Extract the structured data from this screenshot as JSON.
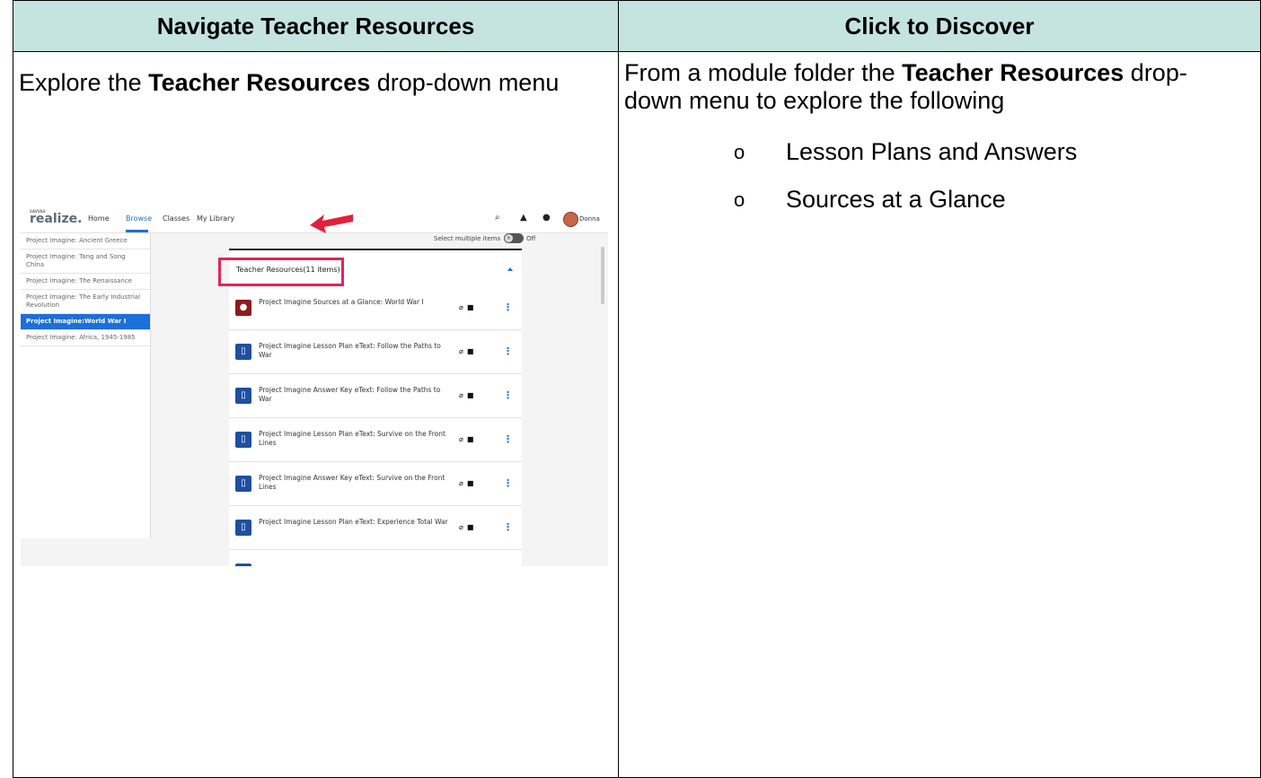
{
  "table": {
    "left_header": "Navigate Teacher Resources",
    "right_header": "Click to Discover",
    "left_text_pre": "Explore the ",
    "left_text_bold": "Teacher Resources",
    "left_text_post": " drop-down menu",
    "right_text_pre": "From a module folder the ",
    "right_text_bold": "Teacher Resources",
    "right_text_post": " drop-down menu to explore the following",
    "bullet_mark": "o",
    "bullets": [
      "Lesson Plans and Answers",
      "Sources at a Glance"
    ]
  },
  "screenshot": {
    "logo_small": "SAVVAS",
    "logo": "realize.",
    "nav": [
      "Home",
      "Browse",
      "Classes",
      "My Library"
    ],
    "active_nav": "Browse",
    "user": "Donna",
    "sidebar": [
      "Project Imagine: Ancient Greece",
      "Project Imagine: Tang and Song China",
      "Project Imagine: The Renaissance",
      "Project Imagine: The Early Industrial Revolution",
      "Project Imagine:World War I",
      "Project Imagine: Africa, 1945-1985"
    ],
    "active_sidebar": "Project Imagine:World War I",
    "select_multiple": "Select multiple items",
    "toggle_label": "Off",
    "folder_title": "Teacher Resources(11 items)",
    "items": [
      {
        "title": "Project Imagine Sources at a Glance: World War I",
        "icon": "apple-icon"
      },
      {
        "title": "Project Imagine Lesson Plan eText: Follow the Paths to War",
        "icon": "book-icon"
      },
      {
        "title": "Project Imagine Answer Key eText: Follow the Paths to War",
        "icon": "book-icon"
      },
      {
        "title": "Project Imagine Lesson Plan eText: Survive on the Front Lines",
        "icon": "book-icon"
      },
      {
        "title": "Project Imagine Answer Key eText: Survive on the Front Lines",
        "icon": "book-icon"
      },
      {
        "title": "Project Imagine Lesson Plan eText: Experience Total War",
        "icon": "book-icon"
      }
    ],
    "colors": {
      "accent": "#1c6fd8",
      "highlight": "#e0245e",
      "header_bg": "#c5e3e0"
    }
  }
}
